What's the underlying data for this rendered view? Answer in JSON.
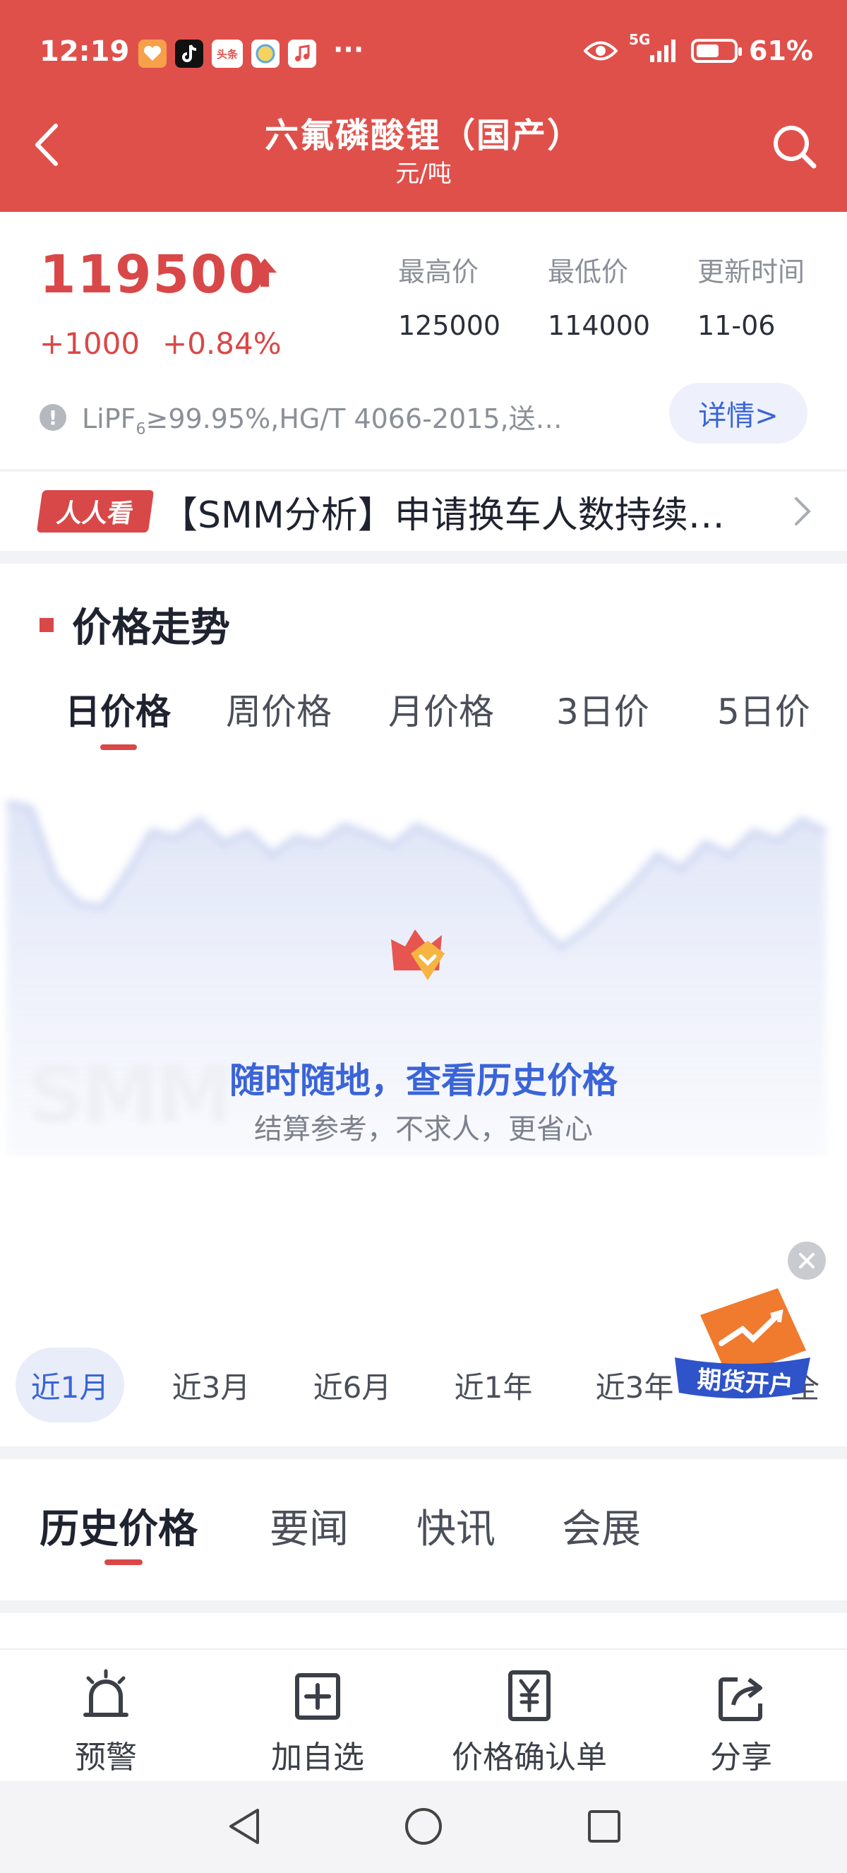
{
  "status_bar": {
    "time": "12:19",
    "apps": [
      "heart-app",
      "tiktok",
      "头条",
      "pill-app",
      "music"
    ],
    "more": "···",
    "network": "5G",
    "battery_level": 0.61,
    "battery": "61%"
  },
  "header": {
    "title": "六氟磷酸锂（国产）",
    "unit": "元/吨"
  },
  "price": {
    "current": "119500",
    "change": "+1000",
    "change_pct": "+0.84%",
    "trend": "up",
    "stats": [
      {
        "label": "最高价",
        "value": "125000"
      },
      {
        "label": "最低价",
        "value": "114000"
      },
      {
        "label": "更新时间",
        "value": "11-06"
      }
    ],
    "spec_prefix": "LiPF",
    "spec_sub": "6",
    "spec_rest": "≥99.95%,HG/T 4066-2015,送…",
    "detail_label": "详情>"
  },
  "news": {
    "badge": "人人看",
    "headline": "【SMM分析】申请换车人数持续…"
  },
  "chart_section": {
    "title": "价格走势",
    "period_tabs": [
      "日价格",
      "周价格",
      "月价格",
      "3日价",
      "5日价"
    ],
    "active_period": 0,
    "overlay_title": "随时随地，查看历史价格",
    "overlay_subtitle": "结算参考，不求人，更省心",
    "watermark": "SMM",
    "range_tabs": [
      "近1月",
      "近3月",
      "近6月",
      "近1年",
      "近3年",
      "全"
    ],
    "active_range": 0,
    "futures_badge": "期货开户"
  },
  "chart_data": {
    "type": "area",
    "blurred": true,
    "values": [
      98,
      96,
      72,
      63,
      62,
      74,
      88,
      86,
      92,
      84,
      88,
      80,
      86,
      84,
      90,
      87,
      83,
      90,
      86,
      82,
      78,
      70,
      56,
      48,
      54,
      62,
      70,
      80,
      75,
      84,
      80,
      88,
      85,
      92,
      88
    ],
    "color": "#c9d3f2"
  },
  "lower_tabs": {
    "items": [
      "历史价格",
      "要闻",
      "快讯",
      "会展"
    ],
    "active": 0
  },
  "bottom_actions": [
    {
      "label": "预警",
      "icon": "alarm-icon"
    },
    {
      "label": "加自选",
      "icon": "add-favorite-icon"
    },
    {
      "label": "价格确认单",
      "icon": "price-receipt-icon"
    },
    {
      "label": "分享",
      "icon": "share-icon"
    }
  ],
  "colors": {
    "header": "#e0504b",
    "accent_red": "#d94848",
    "accent_blue": "#3a64d8"
  }
}
